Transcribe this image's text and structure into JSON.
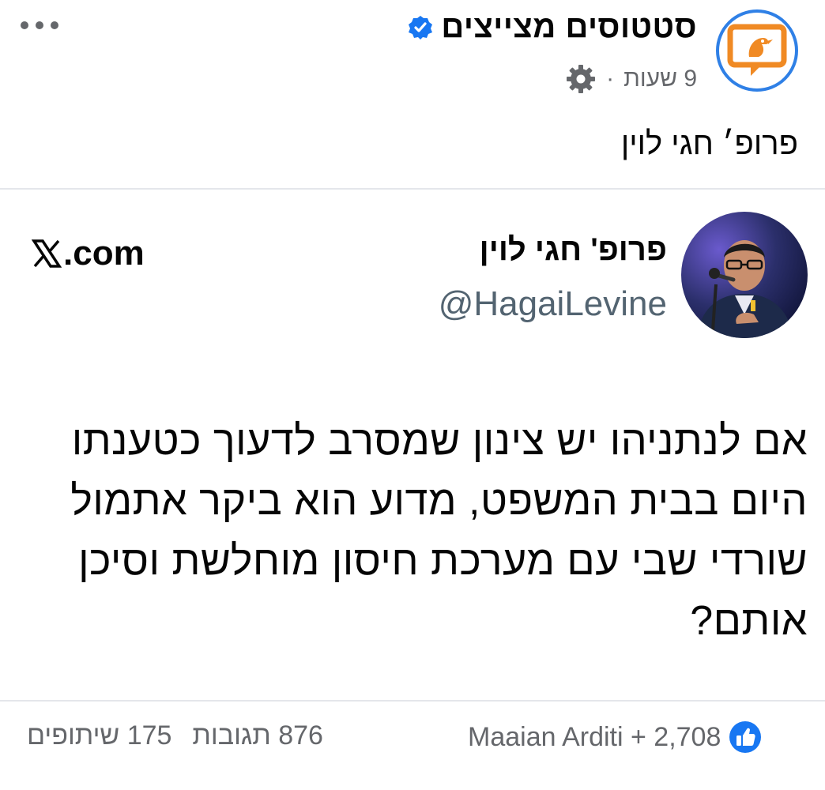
{
  "post": {
    "page_name": "סטטוסים מצייצים",
    "time": "9 שעות",
    "separator": "·",
    "text": "פרופ׳ חגי לוין"
  },
  "tweet": {
    "author_name": "פרופ' חגי לוין",
    "handle": "@HagaiLevine",
    "source": ".com",
    "body_lines": [
      "אם לנתניהו יש צינון שמסרב לדעוך כטענתו",
      "היום בבית המשפט, מדוע הוא ביקר אתמול",
      "שורדי שבי עם מערכת חיסון מוחלשת וסיכן",
      "אותם?"
    ]
  },
  "footer": {
    "reactions_text": "Maaian Arditi + 2,708",
    "comments": "876 תגובות",
    "shares": "175 שיתופים"
  },
  "colors": {
    "facebook_blue": "#1877f2",
    "secondary_text": "#65676b",
    "twitter_handle": "#536471",
    "brand_orange": "#f08a24"
  },
  "icons": [
    "more-icon",
    "verified-badge-icon",
    "gear-icon",
    "x-logo-icon",
    "like-reaction-icon"
  ]
}
